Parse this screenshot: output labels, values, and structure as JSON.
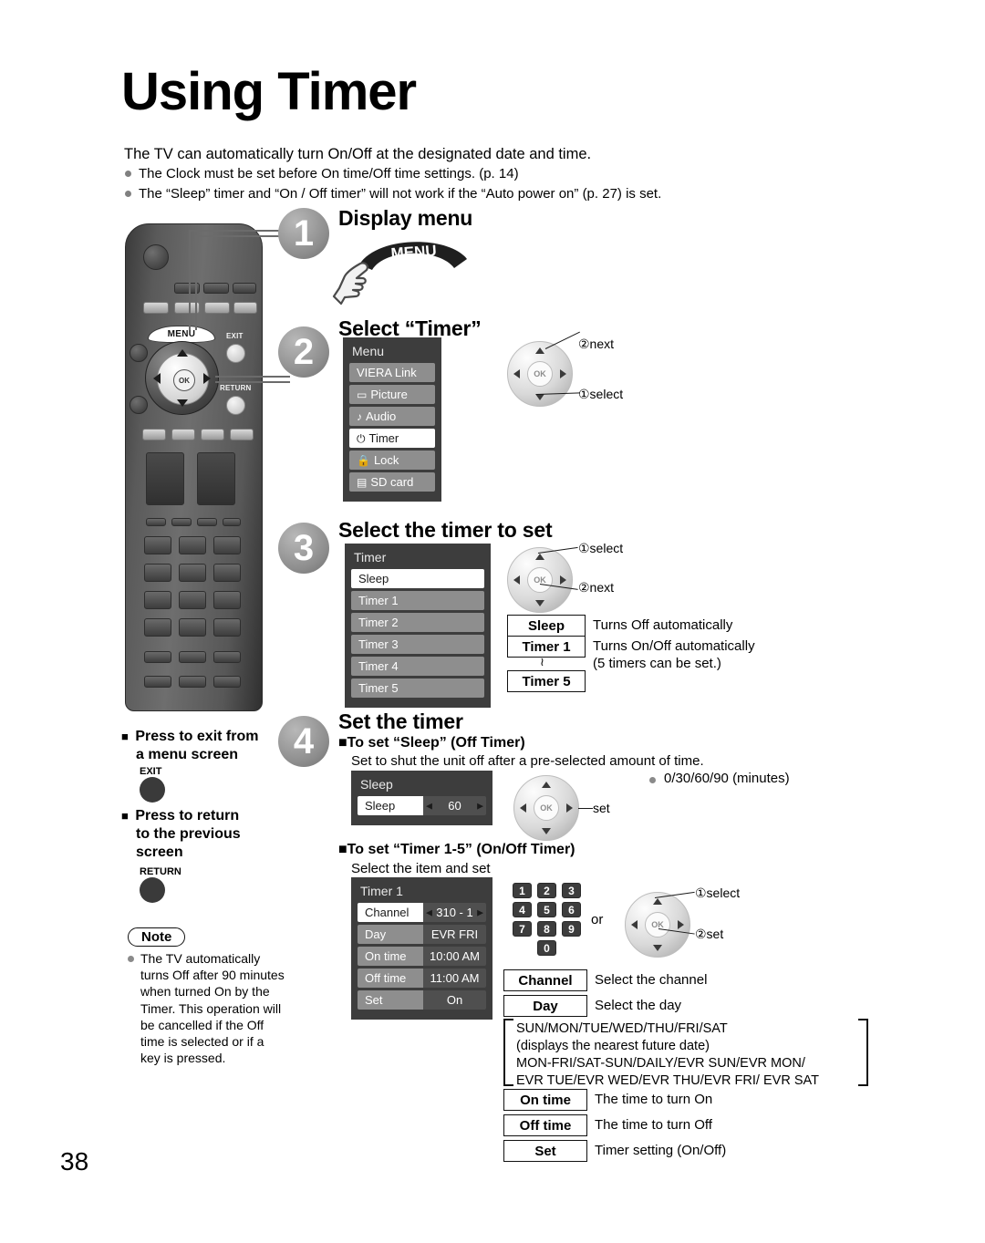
{
  "page": {
    "title": "Using Timer",
    "number": "38",
    "lead": "The TV can automatically turn On/Off at the designated date and time.",
    "bullets": [
      "The Clock must be set before On time/Off time settings. (p. 14)",
      "The “Sleep” timer and “On / Off timer” will not work if the “Auto power on” (p. 27) is set."
    ]
  },
  "remote": {
    "menu_label": "MENU",
    "ok_label": "OK",
    "exit_label": "EXIT",
    "return_label": "RETURN"
  },
  "steps": [
    {
      "num": "1",
      "heading": "Display menu"
    },
    {
      "num": "2",
      "heading": "Select “Timer”"
    },
    {
      "num": "3",
      "heading": "Select the timer to set"
    },
    {
      "num": "4",
      "heading": "Set the timer"
    }
  ],
  "menu_banner": {
    "label": "MENU"
  },
  "menu_osd": {
    "title": "Menu",
    "items": [
      {
        "icon": "",
        "label": "VIERA Link",
        "selected": false
      },
      {
        "icon": "▭",
        "label": "Picture",
        "selected": false
      },
      {
        "icon": "♪",
        "label": "Audio",
        "selected": false
      },
      {
        "icon": "⏻",
        "label": "Timer",
        "selected": true
      },
      {
        "icon": "🔒",
        "label": "Lock",
        "selected": false
      },
      {
        "icon": "▤",
        "label": "SD card",
        "selected": false
      }
    ]
  },
  "timer_osd": {
    "title": "Timer",
    "items": [
      {
        "label": "Sleep",
        "selected": true
      },
      {
        "label": "Timer 1",
        "selected": false
      },
      {
        "label": "Timer 2",
        "selected": false
      },
      {
        "label": "Timer 3",
        "selected": false
      },
      {
        "label": "Timer 4",
        "selected": false
      },
      {
        "label": "Timer 5",
        "selected": false
      }
    ]
  },
  "navpads": {
    "step2": {
      "first": "①select",
      "second": "②next"
    },
    "step3": {
      "first": "①select",
      "second": "②next"
    },
    "sleep": {
      "label": "set"
    },
    "timer1": {
      "first": "①select",
      "second": "②set"
    }
  },
  "timer_legend": [
    {
      "key": "Sleep",
      "desc": "Turns Off automatically"
    },
    {
      "key": "Timer 1",
      "desc": "Turns On/Off automatically"
    },
    {
      "key": "Timer 5",
      "desc": ""
    }
  ],
  "timer_legend_note": "(5 timers can be set.)",
  "timer_legend_tilde": "≀",
  "sleep_section": {
    "heading": "To set “Sleep” (Off Timer)",
    "desc": "Set to shut the unit off after a pre-selected amount of time.",
    "osd_title": "Sleep",
    "row_label": "Sleep",
    "row_value": "60",
    "options_note": "0/30/60/90 (minutes)"
  },
  "timer15_section": {
    "heading": "To set “Timer 1-5” (On/Off Timer)",
    "desc": "Select the item and set",
    "osd_title": "Timer 1",
    "rows": [
      {
        "label": "Channel",
        "value": "310 - 1",
        "selected": true,
        "arrows": true
      },
      {
        "label": "Day",
        "value": "EVR FRI",
        "selected": false,
        "arrows": false
      },
      {
        "label": "On time",
        "value": "10:00 AM",
        "selected": false,
        "arrows": false
      },
      {
        "label": "Off time",
        "value": "11:00 AM",
        "selected": false,
        "arrows": false
      },
      {
        "label": "Set",
        "value": "On",
        "selected": false,
        "arrows": false
      }
    ],
    "numpad": [
      "1",
      "2",
      "3",
      "4",
      "5",
      "6",
      "7",
      "8",
      "9",
      "0"
    ],
    "or_label": "or"
  },
  "field_legend": [
    {
      "key": "Channel",
      "desc": "Select the channel"
    },
    {
      "key": "Day",
      "desc": "Select the day"
    },
    {
      "key": "On time",
      "desc": "The time to turn On"
    },
    {
      "key": "Off time",
      "desc": "The time to turn Off"
    },
    {
      "key": "Set",
      "desc": "Timer setting (On/Off)"
    }
  ],
  "day_options": [
    "SUN/MON/TUE/WED/THU/FRI/SAT",
    "(displays the nearest future date)",
    "MON-FRI/SAT-SUN/DAILY/EVR SUN/EVR MON/",
    "EVR TUE/EVR WED/EVR THU/EVR FRI/ EVR SAT"
  ],
  "left_notes": {
    "exit_heading": "Press to exit from a menu screen",
    "exit_heading_l1": "Press to exit from",
    "exit_heading_l2": "a menu screen",
    "exit_button": "EXIT",
    "return_heading_l1": "Press to return",
    "return_heading_l2": "to the previous",
    "return_heading_l3": "screen",
    "return_button": "RETURN",
    "note_pill": "Note",
    "note_text": "The TV automatically turns Off after 90 minutes when turned On by the Timer. This operation will be cancelled if the Off time is selected or if a key is pressed."
  },
  "colors": {
    "osd_bg": "#3d3d3d",
    "osd_item": "#8e8e8e",
    "osd_sel": "#ffffff",
    "osd_value": "#4f4f4f",
    "step_circle": "#8d8d8d"
  }
}
